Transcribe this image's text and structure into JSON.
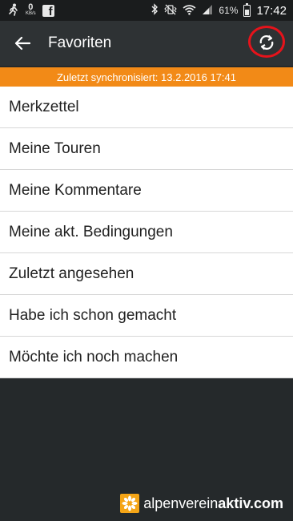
{
  "status_bar": {
    "net_speed_value": "0",
    "net_speed_unit": "KB/s",
    "battery_percent": "61%",
    "battery_level": 0.61,
    "time": "17:42"
  },
  "app_bar": {
    "title": "Favoriten"
  },
  "sync_banner": {
    "text": "Zuletzt synchronisiert: 13.2.2016 17:41"
  },
  "list": {
    "items": [
      {
        "label": "Merkzettel"
      },
      {
        "label": "Meine Touren"
      },
      {
        "label": "Meine Kommentare"
      },
      {
        "label": "Meine akt. Bedingungen"
      },
      {
        "label": "Zuletzt angesehen"
      },
      {
        "label": "Habe ich schon gemacht"
      },
      {
        "label": "Möchte ich noch machen"
      }
    ]
  },
  "brand": {
    "prefix": "alpenverein",
    "suffix": "aktiv.com"
  },
  "colors": {
    "accent": "#f28a17",
    "highlight_ring": "#e5131b",
    "app_bar": "#2e3234",
    "background": "#25292b"
  }
}
